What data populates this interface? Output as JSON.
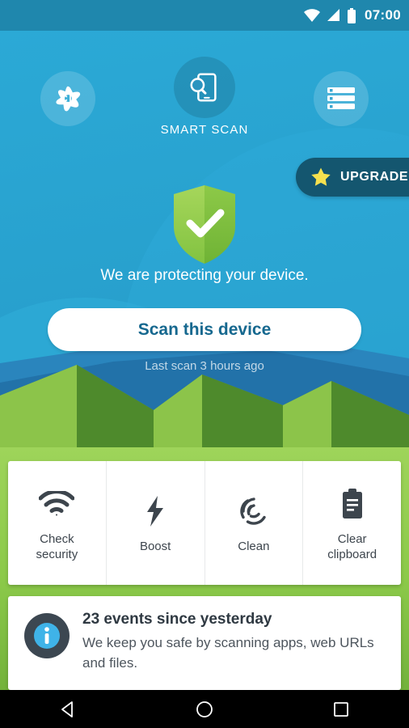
{
  "statusbar": {
    "time": "07:00",
    "icons": [
      "wifi-icon",
      "signal-icon",
      "battery-icon"
    ]
  },
  "header": {
    "left_icon": "avast-logo-icon",
    "center_icon": "smart-scan-icon",
    "right_icon": "menu-list-icon",
    "smart_scan_label": "SMART SCAN"
  },
  "upgrade": {
    "label": "UPGRADE",
    "icon": "star-icon",
    "bg_color": "#14566f",
    "star_color": "#f5e14f"
  },
  "protection": {
    "shield_icon": "shield-check-icon",
    "status_text": "We are protecting your device.",
    "scan_button_label": "Scan this device",
    "last_scan_text": "Last scan 3 hours ago",
    "shield_color": "#8cc63f",
    "accent_color": "#16688f"
  },
  "actions": [
    {
      "icon": "wifi-icon",
      "label": "Check\nsecurity"
    },
    {
      "icon": "bolt-icon",
      "label": "Boost"
    },
    {
      "icon": "clean-swirl-icon",
      "label": "Clean"
    },
    {
      "icon": "clipboard-icon",
      "label": "Clear\nclipboard"
    }
  ],
  "events": {
    "icon": "info-icon",
    "headline": "23 events since yesterday",
    "body": "We keep you safe by scanning apps, web URLs and files."
  },
  "navbar": {
    "back": "back-triangle-icon",
    "home": "home-circle-icon",
    "recents": "recents-square-icon"
  },
  "theme": {
    "sky": "#29a4d2",
    "statusbar": "#1f87ad",
    "ground": "#8bc949",
    "card": "#ffffff"
  }
}
